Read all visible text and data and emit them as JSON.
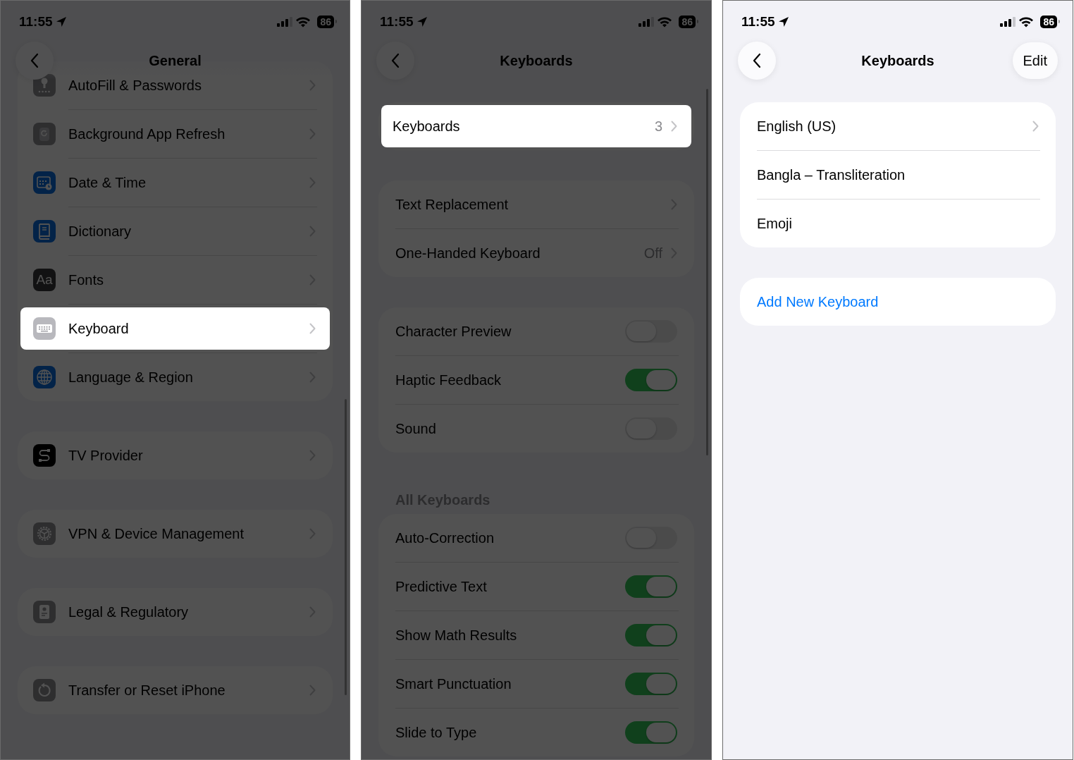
{
  "screens": [
    {
      "dimmed": true,
      "status": {
        "time": "11:55",
        "battery": "86"
      },
      "nav": {
        "title": "General",
        "back": true
      },
      "groups": [
        {
          "rows": [
            {
              "kind": "nav",
              "label": "AutoFill & Passwords",
              "highlighted": false
            },
            {
              "kind": "nav",
              "label": "Background App Refresh",
              "highlighted": false
            },
            {
              "kind": "nav",
              "label": "Date & Time",
              "highlighted": false
            },
            {
              "kind": "nav",
              "label": "Dictionary",
              "highlighted": false
            },
            {
              "kind": "nav",
              "label": "Fonts",
              "icon_text": "Aa",
              "highlighted": false
            },
            {
              "kind": "nav",
              "label": "Keyboard",
              "highlighted": true
            },
            {
              "kind": "nav",
              "label": "Language & Region",
              "highlighted": false
            }
          ]
        },
        {
          "rows": [
            {
              "kind": "nav",
              "label": "TV Provider",
              "highlighted": false
            }
          ]
        },
        {
          "rows": [
            {
              "kind": "nav",
              "label": "VPN & Device Management",
              "highlighted": false
            }
          ]
        },
        {
          "rows": [
            {
              "kind": "nav",
              "label": "Legal & Regulatory",
              "highlighted": false
            }
          ]
        },
        {
          "rows": [
            {
              "kind": "nav",
              "label": "Transfer or Reset iPhone",
              "highlighted": false
            }
          ]
        }
      ]
    },
    {
      "dimmed": true,
      "status": {
        "time": "11:55",
        "battery": "86"
      },
      "nav": {
        "title": "Keyboards",
        "back": true
      },
      "groups": [
        {
          "rows": [
            {
              "kind": "nav",
              "label": "Keyboards",
              "value": "3",
              "highlighted": true
            }
          ]
        },
        {
          "rows": [
            {
              "kind": "nav",
              "label": "Text Replacement",
              "highlighted": false
            },
            {
              "kind": "nav",
              "label": "One-Handed Keyboard",
              "value": "Off",
              "highlighted": false
            }
          ]
        },
        {
          "rows": [
            {
              "kind": "toggle",
              "label": "Character Preview",
              "on": false
            },
            {
              "kind": "toggle",
              "label": "Haptic Feedback",
              "on": true
            },
            {
              "kind": "toggle",
              "label": "Sound",
              "on": false
            }
          ]
        },
        {
          "header": "All Keyboards",
          "rows": [
            {
              "kind": "toggle",
              "label": "Auto-Correction",
              "on": false
            },
            {
              "kind": "toggle",
              "label": "Predictive Text",
              "on": true
            },
            {
              "kind": "toggle",
              "label": "Show Math Results",
              "on": true
            },
            {
              "kind": "toggle",
              "label": "Smart Punctuation",
              "on": true
            },
            {
              "kind": "toggle",
              "label": "Slide to Type",
              "on": true
            }
          ]
        }
      ]
    },
    {
      "dimmed": false,
      "status": {
        "time": "11:55",
        "battery": "86"
      },
      "nav": {
        "title": "Keyboards",
        "back": true,
        "action": "Edit"
      },
      "groups": [
        {
          "rows": [
            {
              "kind": "nav",
              "label": "English (US)"
            },
            {
              "kind": "plain",
              "label": "Bangla – Transliteration"
            },
            {
              "kind": "plain",
              "label": "Emoji"
            }
          ]
        },
        {
          "rows": [
            {
              "kind": "link",
              "label": "Add New Keyboard"
            }
          ]
        }
      ]
    }
  ]
}
